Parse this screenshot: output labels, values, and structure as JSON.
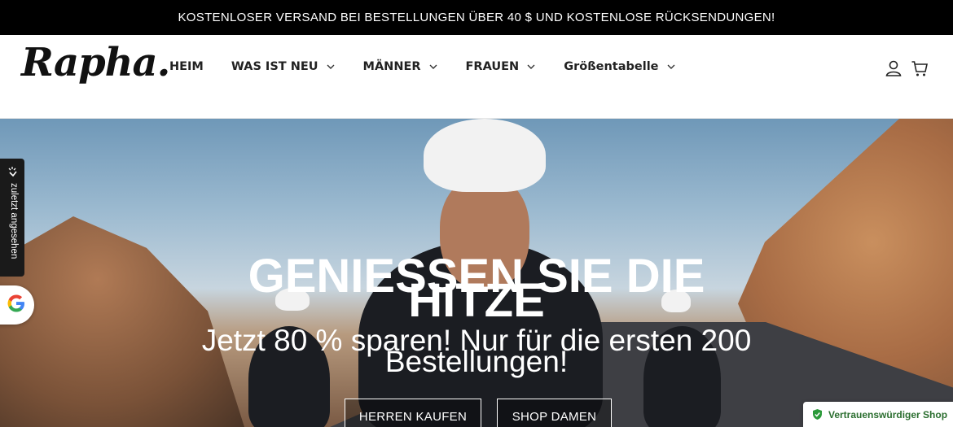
{
  "announcement": "KOSTENLOSER VERSAND BEI BESTELLUNGEN ÜBER 40 $ UND KOSTENLOSE RÜCKSENDUNGEN!",
  "header": {
    "logo": "Rapha.",
    "nav": [
      {
        "label": "HEIM",
        "dropdown": false
      },
      {
        "label": "WAS IST NEU",
        "dropdown": true
      },
      {
        "label": "MÄNNER",
        "dropdown": true
      },
      {
        "label": "FRAUEN",
        "dropdown": true
      },
      {
        "label": "Größentabelle",
        "dropdown": true
      }
    ],
    "icons": [
      "account-icon",
      "cart-icon"
    ]
  },
  "hero": {
    "title_line1": "GENIESSEN SIE DIE",
    "title_line2": "HITZE",
    "subtitle_line1": "Jetzt 80 % sparen! Nur für die ersten 200",
    "subtitle_line2": "Bestellungen!",
    "buttons": {
      "men": "HERREN KAUFEN",
      "women": "SHOP DAMEN"
    }
  },
  "side_tab": {
    "label": "zuletzt angesehen"
  },
  "trust_badge": {
    "label": "Vertrauenswürdiger Shop",
    "color": "#2b9a3a"
  }
}
